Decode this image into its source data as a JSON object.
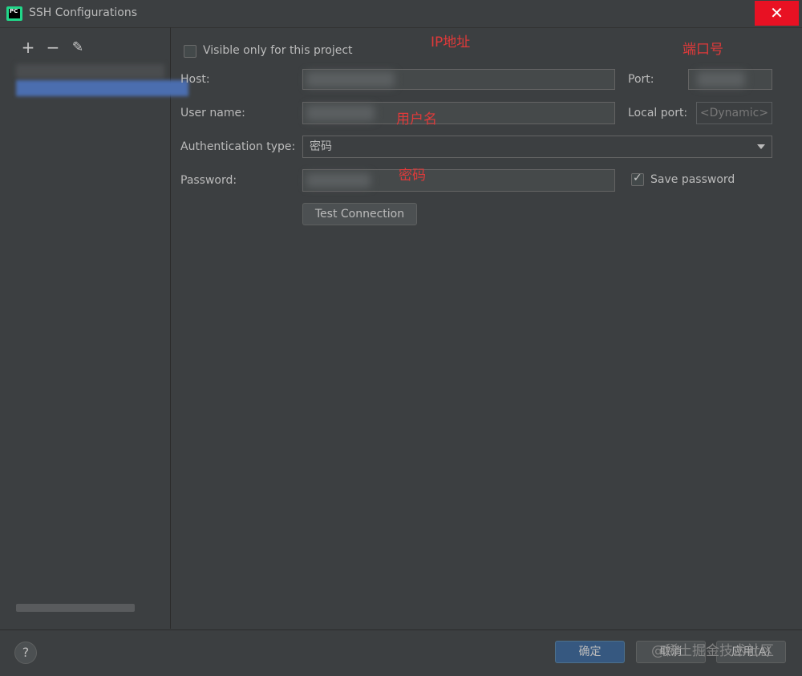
{
  "window": {
    "title": "SSH Configurations",
    "close_glyph": "✕"
  },
  "toolbar": {
    "add_glyph": "+",
    "remove_glyph": "−",
    "edit_glyph": "✎"
  },
  "form": {
    "visible_only_label": "Visible only for this project",
    "host_label": "Host:",
    "port_label": "Port:",
    "username_label": "User name:",
    "local_port_label": "Local port:",
    "local_port_value": "<Dynamic>",
    "auth_type_label": "Authentication type:",
    "auth_type_value": "密码",
    "password_label": "Password:",
    "save_password_label": "Save password",
    "save_password_checked": true,
    "test_connection_label": "Test Connection"
  },
  "annotations": {
    "ip": "IP地址",
    "port": "端口号",
    "username": "用户名",
    "password": "密码"
  },
  "footer": {
    "help_glyph": "?",
    "ok_label": "确定",
    "cancel_label": "取消",
    "apply_label": "应用(A)"
  },
  "watermark": "@稀土掘金技术社区",
  "colors": {
    "background": "#3c3f41",
    "close_button": "#e81123",
    "selection": "#4b6eaf",
    "annotation": "#e03a3a",
    "primary_button": "#365880"
  }
}
